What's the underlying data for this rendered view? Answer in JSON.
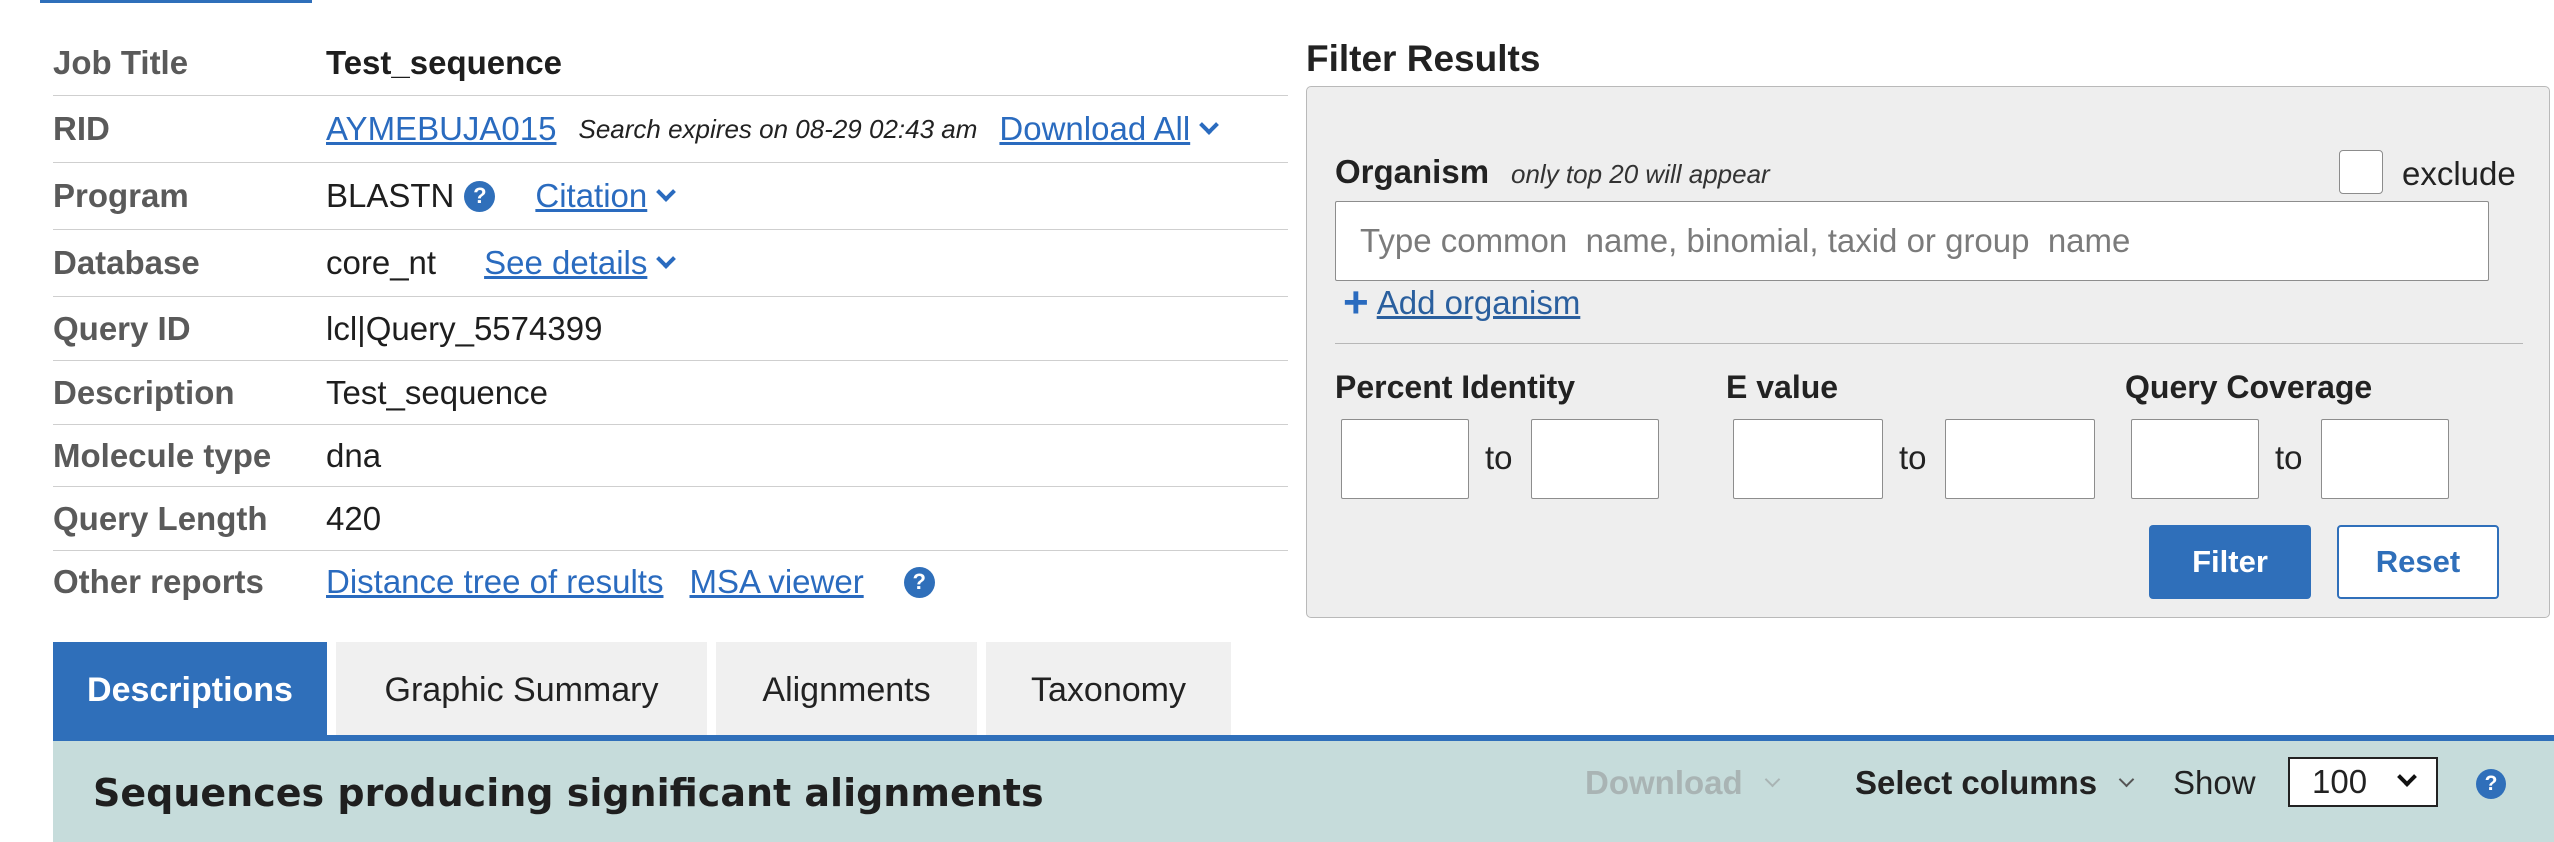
{
  "summary": {
    "job_title": {
      "label": "Job Title",
      "value": "Test_sequence"
    },
    "rid": {
      "label": "RID",
      "value": "AYMEBUJA015",
      "note": "Search expires on 08-29 02:43 am",
      "download_all": "Download All"
    },
    "program": {
      "label": "Program",
      "value": "BLASTN",
      "citation": "Citation"
    },
    "database": {
      "label": "Database",
      "value": "core_nt",
      "details": "See details"
    },
    "query_id": {
      "label": "Query ID",
      "value": "lcl|Query_5574399"
    },
    "description": {
      "label": "Description",
      "value": "Test_sequence"
    },
    "molecule_type": {
      "label": "Molecule type",
      "value": "dna"
    },
    "query_length": {
      "label": "Query Length",
      "value": "420"
    },
    "other_reports": {
      "label": "Other reports",
      "distance_tree": "Distance tree of results",
      "msa_viewer": "MSA viewer"
    }
  },
  "filter": {
    "title": "Filter Results",
    "organism_label": "Organism",
    "organism_note": "only top 20 will appear",
    "exclude_label": "exclude",
    "exclude_checked": false,
    "organism_value": "",
    "organism_placeholder": "Type common  name, binomial, taxid or group  name",
    "add_organism": "Add organism",
    "percent_identity_label": "Percent Identity",
    "evalue_label": "E value",
    "query_coverage_label": "Query Coverage",
    "to_label": "to",
    "percent_identity_from": "",
    "percent_identity_to": "",
    "evalue_from": "",
    "evalue_to": "",
    "query_coverage_from": "",
    "query_coverage_to": "",
    "filter_button": "Filter",
    "reset_button": "Reset"
  },
  "tabs": [
    {
      "label": "Descriptions",
      "active": true
    },
    {
      "label": "Graphic Summary",
      "active": false
    },
    {
      "label": "Alignments",
      "active": false
    },
    {
      "label": "Taxonomy",
      "active": false
    }
  ],
  "results_bar": {
    "title": "Sequences producing significant alignments",
    "download_label": "Download",
    "download_enabled": false,
    "select_columns_label": "Select columns",
    "show_label": "Show",
    "show_value": "100"
  },
  "icons": {
    "help": "?",
    "add": "+"
  },
  "colors": {
    "accent": "#2f6fba",
    "link": "#2a6bbf",
    "results_bar_bg": "#c6dcdb",
    "panel_bg": "#eeeeee"
  }
}
